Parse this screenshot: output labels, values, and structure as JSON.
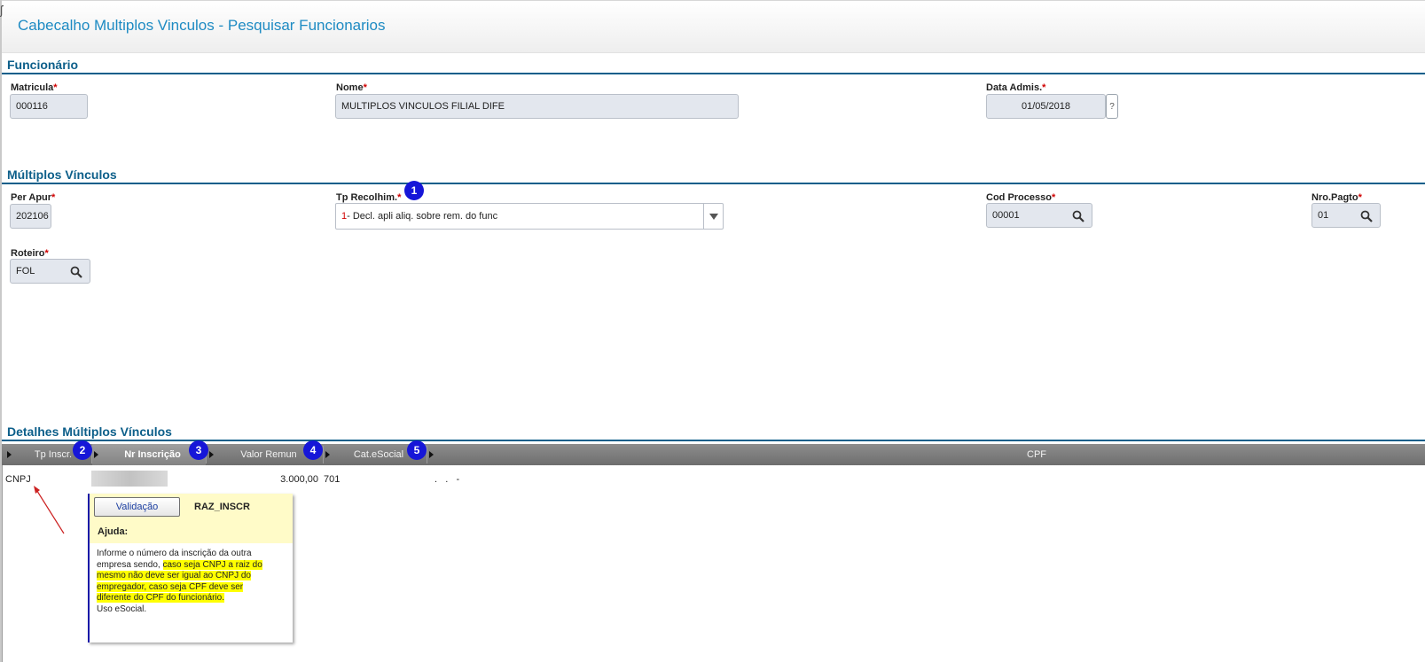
{
  "header": {
    "title": "Cabecalho Multiplos Vinculos - Pesquisar Funcionarios"
  },
  "funcionario": {
    "section_title": "Funcionário",
    "matricula": {
      "label": "Matricula",
      "value": "000116"
    },
    "nome": {
      "label": "Nome",
      "value": "MULTIPLOS VINCULOS FILIAL DIFE"
    },
    "data_admis": {
      "label": "Data Admis.",
      "value": "01/05/2018",
      "help": "?"
    }
  },
  "multiplos": {
    "section_title": "Múltiplos Vínculos",
    "per_apur": {
      "label": "Per Apur",
      "value": "202106"
    },
    "tp_recolhim": {
      "label": "Tp Recolhim.",
      "value_code": "1",
      "value_text": " - Decl. apli aliq. sobre rem. do func"
    },
    "cod_processo": {
      "label": "Cod Processo",
      "value": "00001"
    },
    "nro_pagto": {
      "label": "Nro.Pagto",
      "value": "01"
    },
    "roteiro": {
      "label": "Roteiro",
      "value": "FOL"
    }
  },
  "detalhes": {
    "section_title": "Detalhes Múltiplos Vínculos",
    "columns": [
      "Tp  Inscr.",
      "Nr Inscrição",
      "Valor Remun",
      "Cat.eSocial",
      "CPF"
    ],
    "row": {
      "tp_inscr": "CNPJ",
      "valor_remun": "3.000,00",
      "cat_esocial": "701",
      "cpf": ".   .   -"
    }
  },
  "badges": [
    "1",
    "2",
    "3",
    "4",
    "5"
  ],
  "required_mark": "*",
  "tooltip": {
    "button_label": "Validação",
    "field_name": "RAZ_INSCR",
    "help_title": "Ajuda:",
    "text_1": "Informe o número da  inscrição da outra empresa sendo, ",
    "text_highlight": "caso seja CNPJ a raiz do mesmo não deve ser igual ao CNPJ do empregador, caso seja CPF deve ser diferente do CPF do funcionário.",
    "text_2": "Uso eSocial."
  },
  "colors": {
    "header_title": "#1e8bc3",
    "section": "#0d5f8a",
    "badge": "#1616d8",
    "required": "#d00000",
    "highlight": "#ffff00",
    "arrow": "#cc2222"
  },
  "icons": [
    "search-icon",
    "chevron-down-icon",
    "grid-arrow-icon",
    "annotation-arrow"
  ]
}
